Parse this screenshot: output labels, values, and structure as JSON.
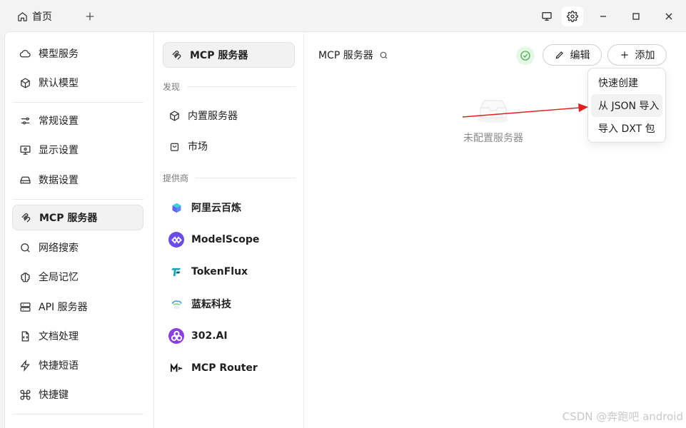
{
  "titlebar": {
    "tab_label": "首页",
    "tab_icon": "home-icon",
    "add_tab_icon": "plus-icon",
    "buttons": [
      "monitor-icon",
      "gear-icon",
      "minimize-icon",
      "maximize-icon",
      "close-icon"
    ]
  },
  "sidebar": {
    "items": [
      {
        "label": "模型服务",
        "icon": "cloud-icon"
      },
      {
        "label": "默认模型",
        "icon": "cube-icon"
      },
      {
        "label": "常规设置",
        "icon": "sliders-icon"
      },
      {
        "label": "显示设置",
        "icon": "monitor-settings-icon"
      },
      {
        "label": "数据设置",
        "icon": "storage-icon"
      },
      {
        "label": "MCP 服务器",
        "icon": "mcp-icon",
        "active": true
      },
      {
        "label": "网络搜索",
        "icon": "search-icon"
      },
      {
        "label": "全局记忆",
        "icon": "brain-icon"
      },
      {
        "label": "API 服务器",
        "icon": "server-icon"
      },
      {
        "label": "文档处理",
        "icon": "file-code-icon"
      },
      {
        "label": "快捷短语",
        "icon": "zap-icon"
      },
      {
        "label": "快捷键",
        "icon": "command-icon"
      }
    ]
  },
  "mcp_nav": {
    "active_label": "MCP 服务器",
    "discover_label": "发现",
    "discover_items": [
      {
        "label": "内置服务器",
        "icon": "cube-icon"
      },
      {
        "label": "市场",
        "icon": "shopping-bag-icon"
      }
    ],
    "providers_label": "提供商",
    "providers": [
      {
        "label": "阿里云百炼",
        "icon": "bailian-logo-icon",
        "color": "#3b82f6"
      },
      {
        "label": "ModelScope",
        "icon": "modelscope-logo-icon",
        "color": "#6b4ce6"
      },
      {
        "label": "TokenFlux",
        "icon": "tokenflux-logo-icon",
        "color": "#1aa6b7"
      },
      {
        "label": "蓝耘科技",
        "icon": "lanyun-logo-icon",
        "color": "#3aa0d8"
      },
      {
        "label": "302.AI",
        "icon": "302ai-logo-icon",
        "color": "#8b3fe0"
      },
      {
        "label": "MCP Router",
        "icon": "mcp-router-logo-icon",
        "color": "#111111"
      }
    ]
  },
  "main": {
    "title": "MCP 服务器",
    "edit_label": "编辑",
    "add_label": "添加",
    "empty_text": "未配置服务器",
    "status_color": "#4caf50"
  },
  "add_menu": {
    "items": [
      "快速创建",
      "从 JSON 导入",
      "导入 DXT 包"
    ],
    "hovered_index": 1
  },
  "watermark": "CSDN @奔跑吧 android"
}
